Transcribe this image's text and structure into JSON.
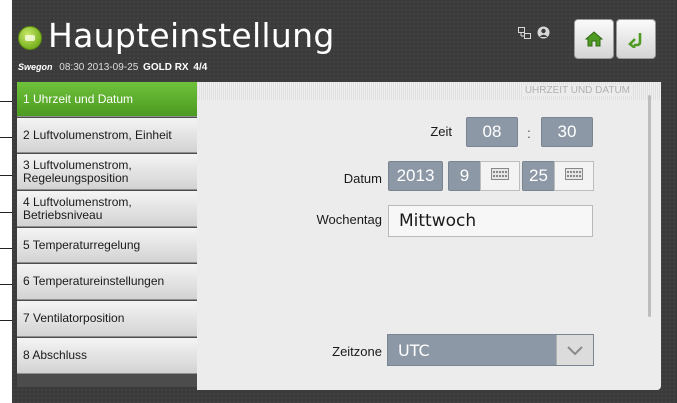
{
  "header": {
    "title": "Haupteinstellung",
    "brand": "Swegon",
    "datetime": "08:30 2013-09-25",
    "model": "GOLD RX",
    "page": "4/4"
  },
  "menu": {
    "items": [
      {
        "label": "1 Uhrzeit und Datum",
        "active": true
      },
      {
        "label": "2 Luftvolumenstrom, Einheit"
      },
      {
        "label": "3 Luftvolumenstrom, Regeleungsposition"
      },
      {
        "label": "4 Luftvolumenstrom, Betriebsniveau"
      },
      {
        "label": "5 Temperaturregelung"
      },
      {
        "label": "6 Temperatureinstellungen"
      },
      {
        "label": "7 Ventilatorposition"
      },
      {
        "label": "8 Abschluss"
      }
    ]
  },
  "panel": {
    "title": "UHRZEIT UND DATUM",
    "time_label": "Zeit",
    "hour": "08",
    "time_sep": ":",
    "minute": "30",
    "date_label": "Datum",
    "year": "2013",
    "month": "9",
    "day": "25",
    "weekday_label": "Wochentag",
    "weekday": "Mittwoch",
    "timezone_label": "Zeitzone",
    "timezone": "UTC"
  },
  "icons": {
    "home": "home-icon",
    "back": "back-arrow-icon",
    "calendar": "calendar-icon",
    "dropdown": "chevron-down-icon",
    "network": "network-icon",
    "user": "user-icon"
  },
  "colors": {
    "accent_green": "#5aab2c",
    "field_blue_gray": "#8d98a6",
    "panel_bg": "#ececec",
    "device_bg": "#3b3b3b"
  }
}
